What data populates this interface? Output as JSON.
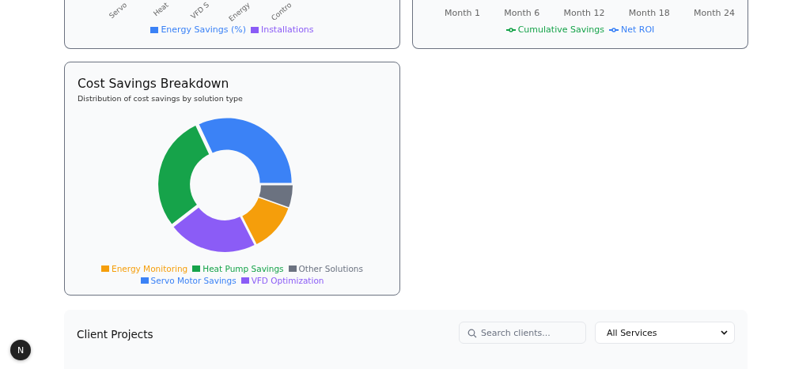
{
  "energy_chart_card": {
    "axis_labels": [
      "Servo",
      "Heat",
      "VFD S",
      "Energy",
      "Contro"
    ],
    "legend": [
      {
        "label": "Energy Savings (%)",
        "color": "#3b82f6"
      },
      {
        "label": "Installations",
        "color": "#8b5cf6"
      }
    ]
  },
  "roi_chart_card": {
    "axis_labels": [
      "Month 1",
      "Month 6",
      "Month 12",
      "Month 18",
      "Month 24"
    ],
    "legend": [
      {
        "label": "Cumulative Savings",
        "color": "#16a34a"
      },
      {
        "label": "Net ROI",
        "color": "#3b82f6"
      }
    ]
  },
  "cost_savings_card": {
    "title": "Cost Savings Breakdown",
    "subtitle": "Distribution of cost savings by solution type",
    "legend": [
      {
        "label": "Energy Monitoring",
        "color": "#f59e0b"
      },
      {
        "label": "Heat Pump Savings",
        "color": "#16a34a"
      },
      {
        "label": "Other Solutions",
        "color": "#6b7280"
      },
      {
        "label": "Servo Motor Savings",
        "color": "#3b82f6"
      },
      {
        "label": "VFD Optimization",
        "color": "#8b5cf6"
      }
    ]
  },
  "client_projects": {
    "title": "Client Projects",
    "search": {
      "placeholder": "Search clients..."
    },
    "filter": {
      "value": "All Services"
    }
  },
  "dev_badge": {
    "label": "N"
  }
}
